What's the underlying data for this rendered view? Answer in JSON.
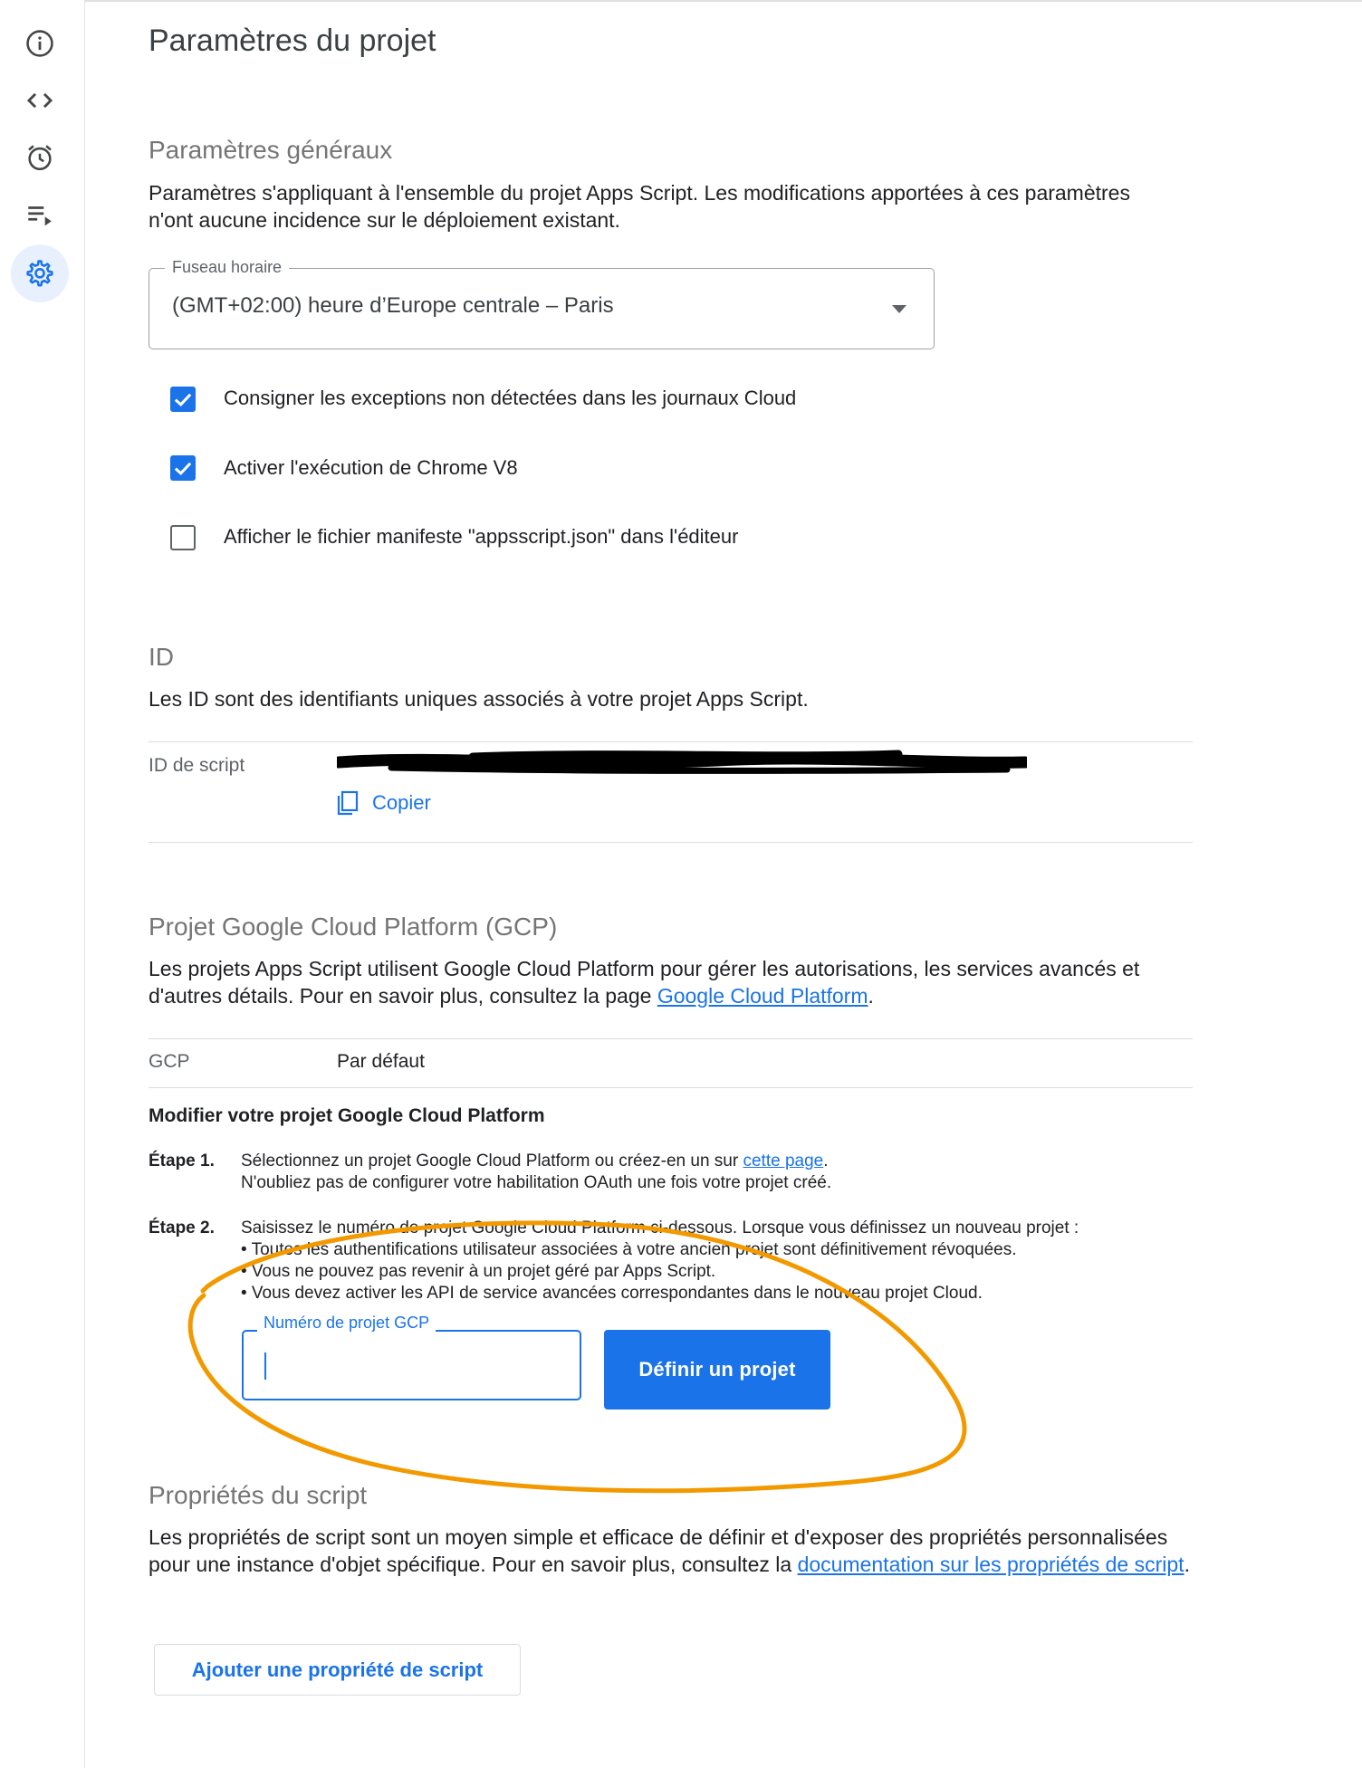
{
  "page": {
    "title": "Paramètres du projet"
  },
  "rail": {
    "items": [
      {
        "icon": "info-icon",
        "label": "Aperçu"
      },
      {
        "icon": "code-icon",
        "label": "Éditeur"
      },
      {
        "icon": "alarm-icon",
        "label": "Déclencheurs"
      },
      {
        "icon": "executions-icon",
        "label": "Exécutions"
      },
      {
        "icon": "gear-icon",
        "label": "Paramètres du projet",
        "active": true
      }
    ]
  },
  "general": {
    "title": "Paramètres généraux",
    "description": "Paramètres s'appliquant à l'ensemble du projet Apps Script. Les modifications apportées à ces paramètres n'ont aucune incidence sur le déploiement existant.",
    "timezone": {
      "label": "Fuseau horaire",
      "value": "(GMT+02:00) heure d’Europe centrale – Paris"
    },
    "checkboxes": [
      {
        "label": "Consigner les exceptions non détectées dans les journaux Cloud",
        "checked": true
      },
      {
        "label": "Activer l'exécution de Chrome V8",
        "checked": true
      },
      {
        "label": "Afficher le fichier manifeste \"appsscript.json\" dans l'éditeur",
        "checked": false
      }
    ]
  },
  "ids": {
    "title": "ID",
    "description": "Les ID sont des identifiants uniques associés à votre projet Apps Script.",
    "script_id_label": "ID de script",
    "copy_label": "Copier"
  },
  "gcp": {
    "title": "Projet Google Cloud Platform (GCP)",
    "description_prefix": "Les projets Apps Script utilisent Google Cloud Platform pour gérer les autorisations, les services avancés et d'autres détails. Pour en savoir plus, consultez la page ",
    "description_link": "Google Cloud Platform",
    "description_suffix": ".",
    "row_key": "GCP",
    "row_value": "Par défaut",
    "modify_title": "Modifier votre projet Google Cloud Platform",
    "step1_key": "Étape 1.",
    "step1_text": "Sélectionnez un projet Google Cloud Platform ou créez-en un sur ",
    "step1_link": "cette page",
    "step1_after_link": ".",
    "step1_text2": "N'oubliez pas de configurer votre habilitation OAuth une fois votre projet créé.",
    "step2_key": "Étape 2.",
    "step2_line1": "Saisissez le numéro de projet Google Cloud Platform ci-dessous. Lorsque vous définissez un nouveau projet :",
    "step2_bullets": [
      "• Toutes les authentifications utilisateur associées à votre ancien projet sont définitivement révoquées.",
      "• Vous ne pouvez pas revenir à un projet géré par Apps Script.",
      "• Vous devez activer les API de service avancées correspondantes dans le nouveau projet Cloud."
    ],
    "input_label": "Numéro de projet GCP",
    "input_value": "",
    "set_button": "Définir un projet"
  },
  "props": {
    "title": "Propriétés du script",
    "description_prefix": "Les propriétés de script sont un moyen simple et efficace de définir et d'exposer des propriétés personnalisées pour une instance d'objet spécifique. Pour en savoir plus, consultez la ",
    "description_link": "documentation sur les propriétés de script",
    "description_suffix": ".",
    "add_button": "Ajouter une propriété de script"
  },
  "colors": {
    "accent": "#1a73e8",
    "annotation": "#f29900",
    "redaction": "#000000"
  }
}
